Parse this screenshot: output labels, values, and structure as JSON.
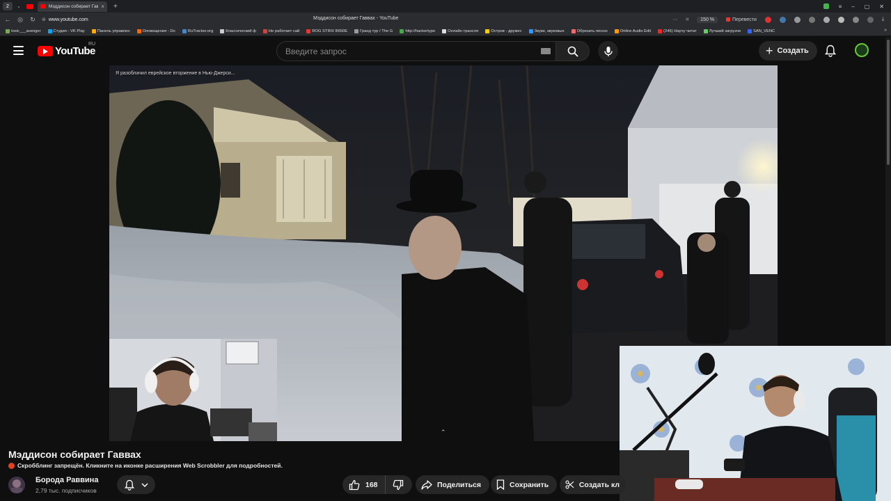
{
  "browser": {
    "tab_count": "2",
    "active_tab_title": "Мэддисон собирает Гавв",
    "url": "www.youtube.com",
    "window_title": "Мэддисон собирает Гаввах - YouTube",
    "zoom": "150 %",
    "translate": "Перевести",
    "bookmarks": [
      {
        "label": "toxic___avenger",
        "color": "#7a5"
      },
      {
        "label": "Студия - VK Play",
        "color": "#0af"
      },
      {
        "label": "Панель управлен",
        "color": "#fa0"
      },
      {
        "label": "Оповещения - Do",
        "color": "#f60"
      },
      {
        "label": "RuTracker.org",
        "color": "#48c"
      },
      {
        "label": "Классический ф",
        "color": "#ccc"
      },
      {
        "label": "Не работает сай",
        "color": "#c44"
      },
      {
        "label": "ROG STRIX B650E",
        "color": "#e33"
      },
      {
        "label": "Гранд тур / The G",
        "color": "#999"
      },
      {
        "label": "http://hackertype",
        "color": "#4a4"
      },
      {
        "label": "Онлайн трансля",
        "color": "#ddd"
      },
      {
        "label": "Остров - дружес",
        "color": "#fc0"
      },
      {
        "label": "Звуки, звуковые",
        "color": "#39f"
      },
      {
        "label": "Обрезать песню",
        "color": "#f66"
      },
      {
        "label": "Online Audio Edit",
        "color": "#f90"
      },
      {
        "label": "(246) Научу читат",
        "color": "#f22"
      },
      {
        "label": "Лучший загрузчи",
        "color": "#6c6"
      },
      {
        "label": "SAN_VENC",
        "color": "#36f"
      }
    ]
  },
  "header": {
    "logo_text": "YouTube",
    "region": "RU",
    "search_placeholder": "Введите запрос",
    "create_label": "Создать"
  },
  "player": {
    "overlay_title": "Я разоблачил еврейское вторжение в Нью-Джерси..."
  },
  "video": {
    "title": "Мэддисон собирает Гаввах",
    "scrobbler_notice": "Скробблинг запрещён. Кликните на иконке расширения Web Scrobbler для подробностей.",
    "channel_name": "Борода Раввина",
    "subscribers": "2,79 тыс. подписчиков",
    "likes": "168",
    "share_label": "Поделиться",
    "save_label": "Сохранить",
    "clip_label": "Создать кл"
  },
  "colors": {
    "brand_red": "#ff0000",
    "background": "#0f0f0f",
    "pill": "#272727"
  }
}
